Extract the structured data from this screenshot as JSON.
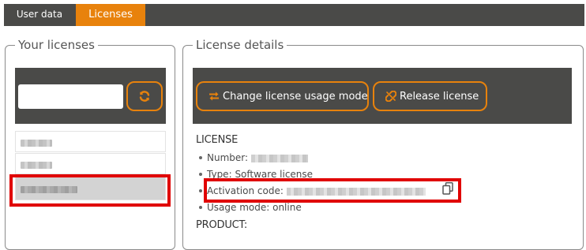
{
  "tabs": {
    "user_data": "User data",
    "licenses": "Licenses",
    "active_color": "#e8820c",
    "bar_color": "#4a4a48"
  },
  "left_panel": {
    "legend": "Your licenses",
    "search": {
      "value": "",
      "placeholder": ""
    },
    "refresh_icon": "refresh-icon",
    "list_items_count_visible": 3,
    "selected_index": 2
  },
  "right_panel": {
    "legend": "License details",
    "buttons": {
      "change_mode": "Change license usage mode",
      "change_mode_icon": "swap-arrows-icon",
      "release": "Release license",
      "release_icon": "broken-link-icon"
    },
    "license_heading": "LICENSE",
    "fields": {
      "number_label": "Number:",
      "type_label": "Type:",
      "type_value": "Software license",
      "code_label": "Activation code:",
      "mode_label": "Usage mode:",
      "mode_value": "online"
    },
    "copy_icon": "copy-icon",
    "product_heading": "PRODUCT:"
  },
  "annotations": {
    "highlight_color": "#e00000"
  }
}
